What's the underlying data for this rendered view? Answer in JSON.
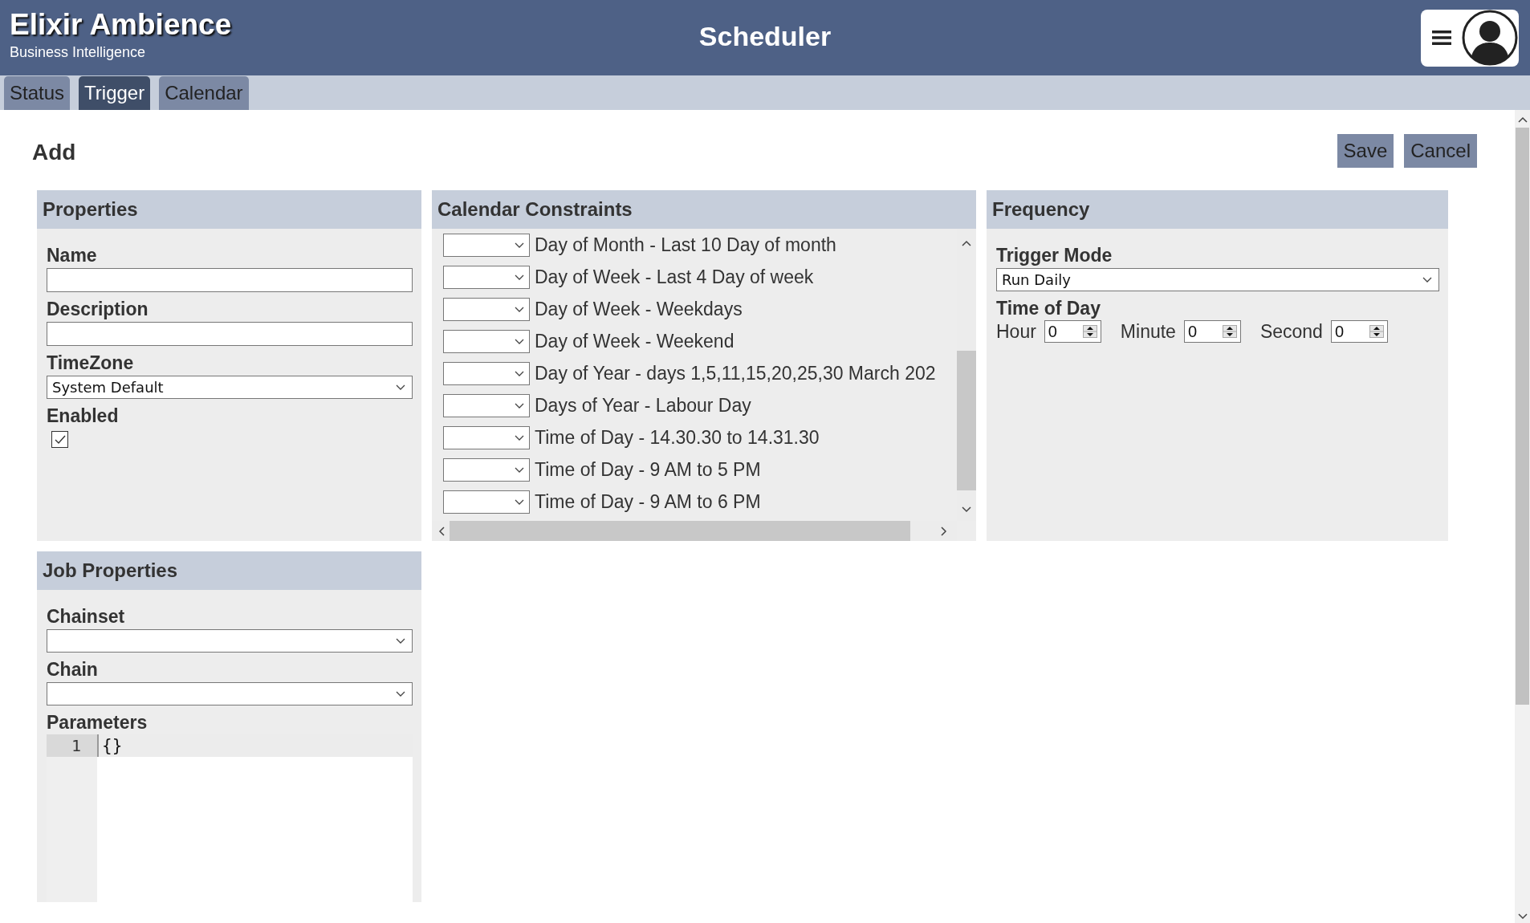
{
  "header": {
    "title": "Elixir Ambience",
    "subtitle": "Business Intelligence",
    "page_title": "Scheduler"
  },
  "tabs": [
    {
      "label": "Status",
      "selected": false
    },
    {
      "label": "Trigger",
      "selected": true
    },
    {
      "label": "Calendar",
      "selected": false
    }
  ],
  "form": {
    "heading": "Add",
    "buttons": [
      "Save",
      "Cancel"
    ]
  },
  "properties": {
    "title": "Properties",
    "fields": [
      {
        "kind": "text",
        "label": "Name"
      },
      {
        "kind": "text",
        "label": "Description"
      },
      {
        "kind": "select",
        "label": "TimeZone",
        "value": "System Default"
      },
      {
        "kind": "checkbox",
        "label": "Enabled",
        "checked": true
      }
    ]
  },
  "calendar_constraints": {
    "title": "Calendar Constraints",
    "items": [
      {
        "label": "Day of Month - Last 10 Day of month"
      },
      {
        "label": "Day of Week - Last 4 Day of week"
      },
      {
        "label": "Day of Week - Weekdays"
      },
      {
        "label": "Day of Week - Weekend"
      },
      {
        "label": "Day of Year - days 1,5,11,15,20,25,30 March 202"
      },
      {
        "label": "Days of Year - Labour Day"
      },
      {
        "label": "Time of Day - 14.30.30 to 14.31.30"
      },
      {
        "label": "Time of Day - 9 AM to 5 PM"
      },
      {
        "label": "Time of Day - 9 AM to 6 PM"
      }
    ]
  },
  "frequency": {
    "title": "Frequency",
    "trigger_mode": {
      "label": "Trigger Mode",
      "value": "Run Daily"
    },
    "time_of_day": {
      "label": "Time of Day",
      "fields": [
        {
          "label": "Hour",
          "value": "0"
        },
        {
          "label": "Minute",
          "value": "0"
        },
        {
          "label": "Second",
          "value": "0"
        }
      ]
    }
  },
  "job_properties": {
    "title": "Job Properties",
    "fields": [
      {
        "kind": "select",
        "label": "Chainset"
      },
      {
        "kind": "select",
        "label": "Chain"
      },
      {
        "kind": "code",
        "label": "Parameters",
        "lines": [
          {
            "number": "1",
            "text": "{}"
          }
        ]
      }
    ]
  }
}
